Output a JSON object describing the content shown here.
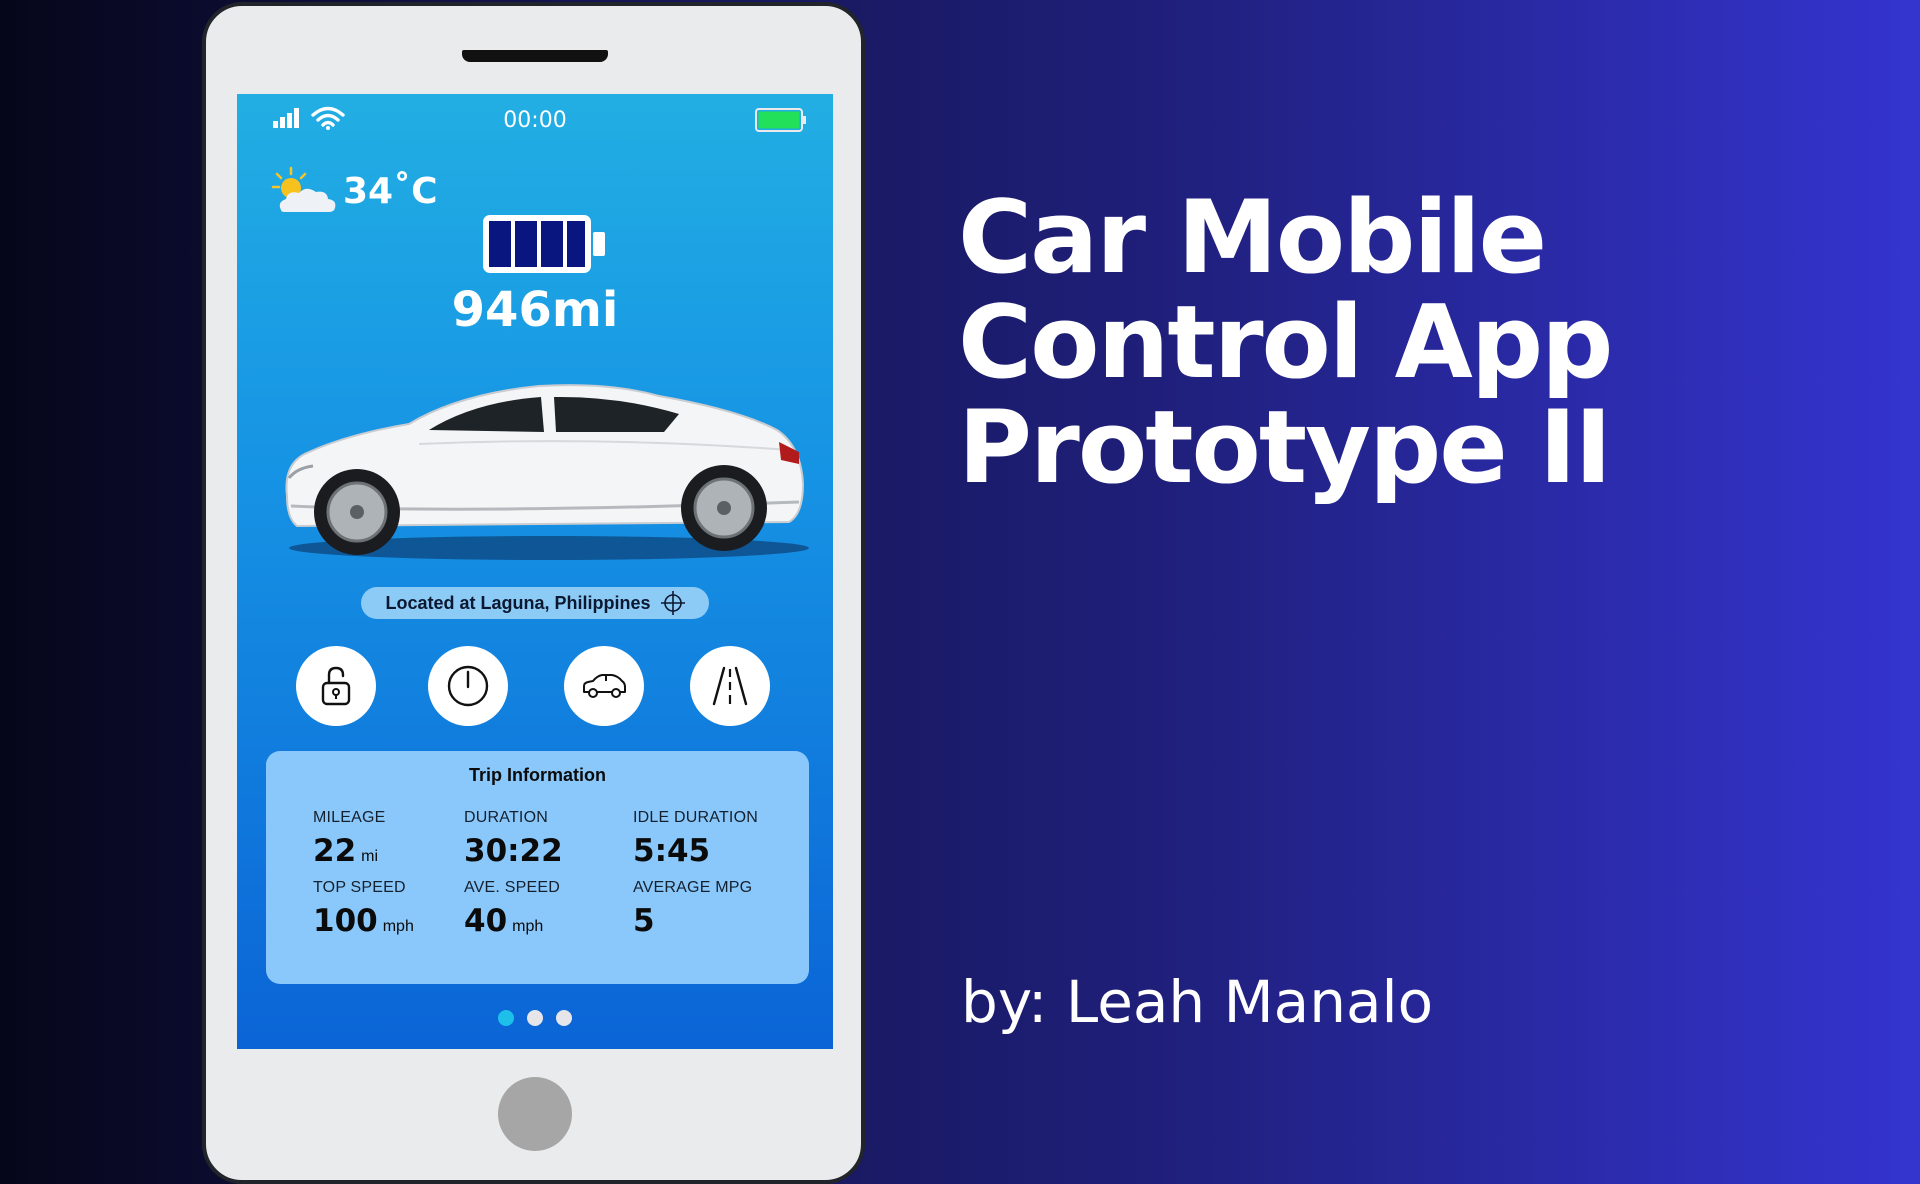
{
  "status_bar": {
    "time": "00:00"
  },
  "weather": {
    "temperature": "34˚C"
  },
  "vehicle": {
    "range": "946mi"
  },
  "location": {
    "text": "Located at Laguna, Philippines"
  },
  "actions": [
    {
      "icon": "unlock-icon"
    },
    {
      "icon": "power-icon"
    },
    {
      "icon": "car-icon"
    },
    {
      "icon": "road-icon"
    }
  ],
  "trip": {
    "title": "Trip Information",
    "stats": [
      {
        "label": "MILEAGE",
        "value": "22",
        "unit": "mi"
      },
      {
        "label": "DURATION",
        "value": "30:22",
        "unit": ""
      },
      {
        "label": "IDLE DURATION",
        "value": "5:45",
        "unit": ""
      },
      {
        "label": "TOP SPEED",
        "value": "100",
        "unit": "mph"
      },
      {
        "label": "AVE. SPEED",
        "value": "40",
        "unit": "mph"
      },
      {
        "label": "AVERAGE MPG",
        "value": "5",
        "unit": ""
      }
    ]
  },
  "pagination": {
    "total": 3,
    "active": 1
  },
  "headline": {
    "line1": "Car Mobile",
    "line2": "Control App",
    "line3": "Prototype II"
  },
  "byline": "by: Leah Manalo",
  "colors": {
    "screen_top": "#22aee3",
    "screen_bottom": "#0b64d6",
    "card": "#8ac8fb",
    "active_dot": "#1ec0ea",
    "battery_fill": "#0a1680",
    "phone_battery": "#22e05a"
  }
}
